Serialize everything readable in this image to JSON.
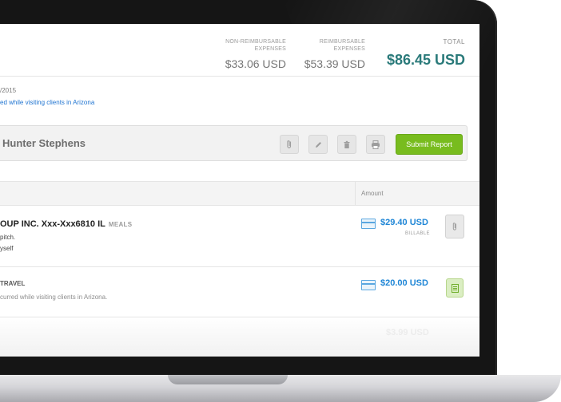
{
  "summary": {
    "non_reimbursable_label_1": "NON-REIMBURSABLE",
    "non_reimbursable_label_2": "EXPENSES",
    "non_reimbursable_amount": "$33.06 USD",
    "reimbursable_label_1": "REIMBURSABLE",
    "reimbursable_label_2": "EXPENSES",
    "reimbursable_amount": "$53.39 USD",
    "total_label": "TOTAL",
    "total_amount": "$86.45 USD"
  },
  "report": {
    "date": "/2015",
    "description": "ed while visiting clients in Arizona",
    "owner": "Hunter Stephens",
    "submit_label": "Submit Report"
  },
  "table": {
    "amount_header": "Amount"
  },
  "expenses": [
    {
      "title": "OUP INC. Xxx-Xxx6810 IL",
      "category": "MEALS",
      "line1": "pitch.",
      "line2": "yself",
      "amount": "$29.40 USD",
      "billable": "BILLABLE"
    },
    {
      "title": "TRAVEL",
      "category": "",
      "line1": "curred while visiting clients in Arizona.",
      "amount": "$20.00 USD"
    },
    {
      "title": "",
      "amount": "$3.99 USD"
    }
  ],
  "colors": {
    "accent_green": "#78bc1e",
    "total_teal": "#2a7a7a",
    "amount_blue": "#1f86d6",
    "link_blue": "#1f74d1"
  }
}
